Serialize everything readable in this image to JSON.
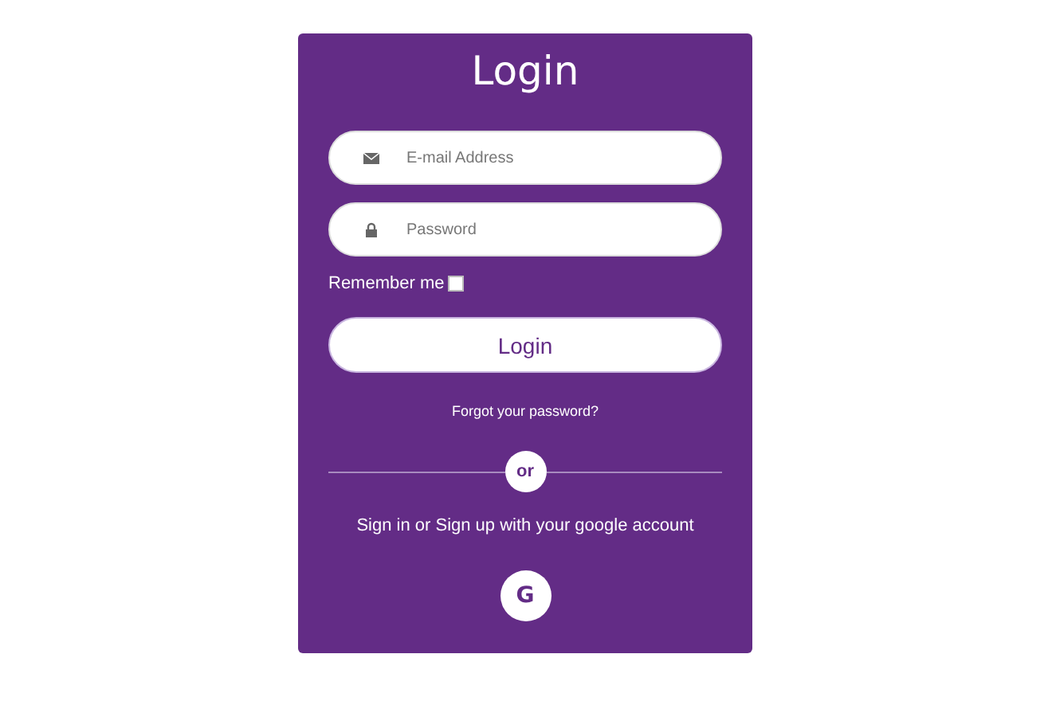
{
  "title": "Login",
  "fields": [
    {
      "kind": "email",
      "placeholder": "E-mail Address"
    },
    {
      "kind": "password",
      "placeholder": "Password"
    }
  ],
  "remember": {
    "label": "Remember me",
    "checked": false
  },
  "login_button": "Login",
  "forgot_link": "Forgot your password?",
  "divider": "or",
  "social_text": "Sign in or Sign up with your google account",
  "google_button": "G"
}
